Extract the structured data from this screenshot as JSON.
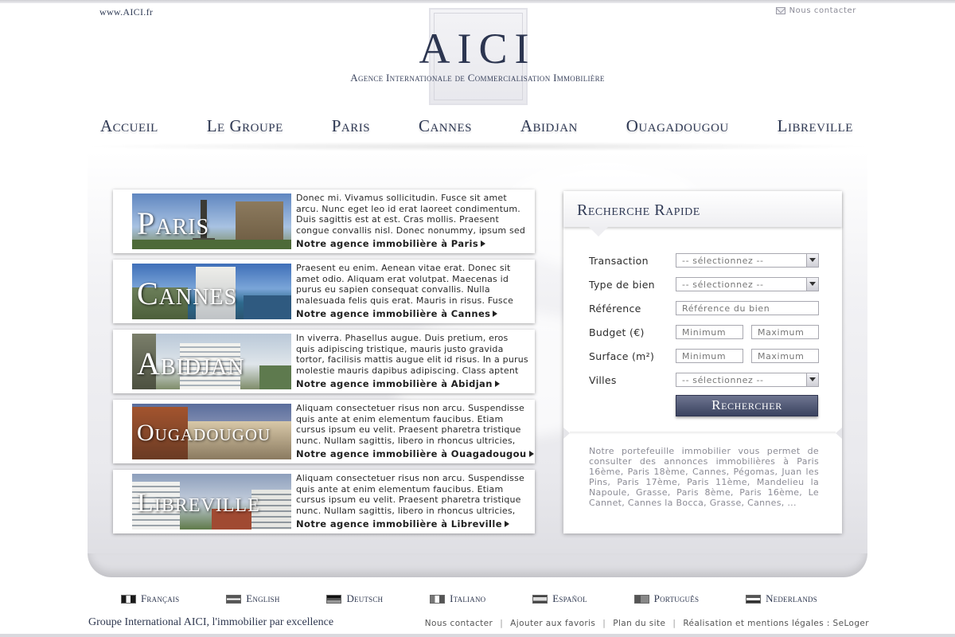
{
  "header": {
    "site_url": "www.AICI.fr",
    "contact_label": "Nous contacter",
    "logo": "AICI",
    "tagline": "Agence Internationale de Commercialisation Immobilière"
  },
  "nav": {
    "items": [
      "Accueil",
      "Le Groupe",
      "Paris",
      "Cannes",
      "Abidjan",
      "Ouagadougou",
      "Libreville"
    ]
  },
  "agencies": [
    {
      "name": "Paris",
      "text": "Donec mi. Vivamus sollicitudin. Fusce sit amet arcu. Nunc eget leo id erat laoreet condimentum. Duis sagittis est at est. Cras mollis. Praesent congue convallis nisl. Donec nonummy, ipsum sed",
      "link": "Notre agence immobilière à Paris"
    },
    {
      "name": "Cannes",
      "text": "Praesent eu enim. Aenean vitae erat. Donec sit amet odio. Aliquam erat volutpat. Maecenas id purus eu sapien consequat convallis. Nulla malesuada felis quis erat. Mauris in risus. Fusce",
      "link": "Notre agence immobilière à Cannes"
    },
    {
      "name": "Abidjan",
      "text": "In viverra. Phasellus augue. Duis pretium, eros quis adipiscing tristique, mauris justo gravida tortor, facilisis mattis augue elit id risus. In a purus molestie mauris dapibus adipiscing. Class aptent",
      "link": "Notre agence immobilière à Abidjan"
    },
    {
      "name": "Ougadougou",
      "text": "Aliquam consectetuer risus non arcu. Suspendisse quis ante at enim elementum faucibus. Etiam cursus ipsum eu velit. Praesent pharetra tristique nunc. Nullam sagittis, libero in rhoncus ultricies,",
      "link": "Notre agence immobilière à Ouagadougou"
    },
    {
      "name": "Libreville",
      "text": "Aliquam consectetuer risus non arcu. Suspendisse quis ante at enim elementum faucibus. Etiam cursus ipsum eu velit. Praesent pharetra tristique nunc. Nullam sagittis, libero in rhoncus ultricies,",
      "link": "Notre agence immobilière à Libreville"
    }
  ],
  "search": {
    "title": "Recherche Rapide",
    "labels": {
      "transaction": "Transaction",
      "type": "Type de bien",
      "reference": "Référence",
      "budget": "Budget (€)",
      "surface": "Surface (m²)",
      "villes": "Villes"
    },
    "select_value": "-- sélectionnez --",
    "reference_placeholder": "Référence du bien",
    "min_placeholder": "Minimum",
    "max_placeholder": "Maximum",
    "button": "Rechercher",
    "portfolio_text": "Notre portefeuille immobilier vous permet de consulter des annonces immobilières à Paris 16ème, Paris 18ème, Cannes, Pégomas, Juan les Pins, Paris 17ème, Paris 11ème, Mandelieu la Napoule, Grasse, Paris 8ème, Paris 16ème, Le Cannet, Cannes la Bocca, Grasse, Cannes, ..."
  },
  "languages": [
    {
      "label": "Français",
      "flag": "french-flag-icon"
    },
    {
      "label": "English",
      "flag": "uk-flag-icon"
    },
    {
      "label": "Deutsch",
      "flag": "german-flag-icon"
    },
    {
      "label": "Italiano",
      "flag": "italian-flag-icon"
    },
    {
      "label": "Español",
      "flag": "spanish-flag-icon"
    },
    {
      "label": "Português",
      "flag": "portuguese-flag-icon"
    },
    {
      "label": "Nederlands",
      "flag": "dutch-flag-icon"
    }
  ],
  "footer": {
    "tagline": "Groupe International AICI, l'immobilier par excellence",
    "links": [
      "Nous contacter",
      "Ajouter aux favoris",
      "Plan du site",
      "Réalisation et mentions légales : SeLoger"
    ]
  },
  "colors": {
    "brand_navy": "#2c3550",
    "button_top": "#6e7590",
    "button_bottom": "#3b4360"
  }
}
